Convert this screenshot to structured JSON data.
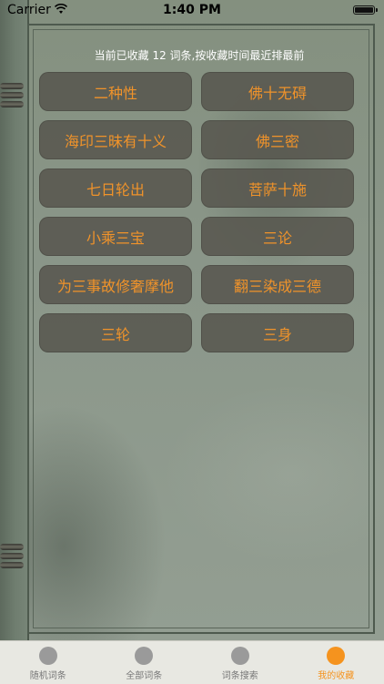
{
  "status_bar": {
    "carrier": "Carrier",
    "time": "1:40 PM"
  },
  "info_text": "当前已收藏 12 词条,按收藏时间最近排最前",
  "terms": [
    "二种性",
    "佛十无碍",
    "海印三昧有十义",
    "佛三密",
    "七日轮出",
    "菩萨十施",
    "小乘三宝",
    "三论",
    "为三事故修奢摩他",
    "翻三染成三德",
    "三轮",
    "三身"
  ],
  "tabs": [
    {
      "label": "随机词条",
      "icon": "random-icon",
      "active": false
    },
    {
      "label": "全部词条",
      "icon": "list-icon",
      "active": false
    },
    {
      "label": "词条搜索",
      "icon": "search-icon",
      "active": false
    },
    {
      "label": "我的收藏",
      "icon": "favorite-icon",
      "active": true
    }
  ],
  "colors": {
    "accent": "#f5931e",
    "term_text": "#f0932a",
    "term_bg": "#58564e"
  }
}
